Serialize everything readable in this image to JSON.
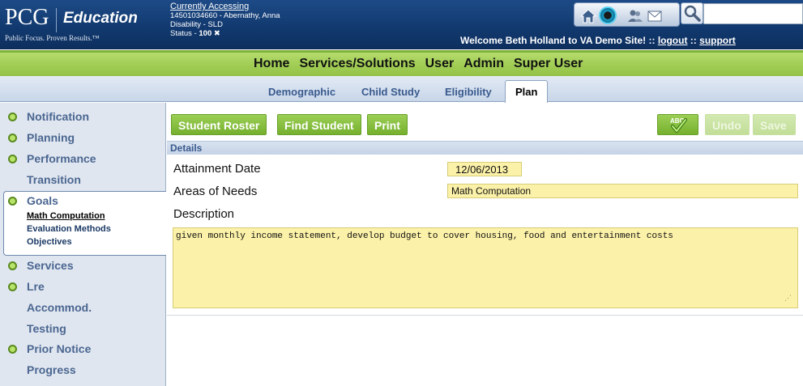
{
  "logo": {
    "brand": "PCG",
    "product": "Education",
    "tagline": "Public Focus. Proven Results.™"
  },
  "accessing": {
    "link_label": "Currently Accessing",
    "student": "14501034660 - Abernathy, Anna",
    "disability": "Disability - SLD",
    "status_prefix": "Status - ",
    "status_value": "100 ✖"
  },
  "header": {
    "icons": [
      "home-icon",
      "circle-icon",
      "users-icon",
      "mail-icon",
      "search-icon"
    ],
    "search_placeholder": "",
    "welcome_text": "Welcome Beth Holland to VA Demo Site!",
    "sep1": " :: ",
    "logout_label": "logout",
    "sep2": " :: ",
    "support_label": "support"
  },
  "main_nav": {
    "items": [
      "Home",
      "Services/Solutions",
      "User",
      "Admin",
      "Super User"
    ]
  },
  "tabs": {
    "items": [
      "Demographic",
      "Child Study",
      "Eligibility",
      "Plan"
    ],
    "active": "Plan"
  },
  "sidebar": {
    "items": [
      {
        "label": "Notification",
        "has_dot": true
      },
      {
        "label": "Planning",
        "has_dot": true
      },
      {
        "label": "Performance",
        "has_dot": true
      },
      {
        "label": "Transition",
        "has_dot": false
      },
      {
        "label": "Goals",
        "has_dot": true
      },
      {
        "label": "Services",
        "has_dot": true
      },
      {
        "label": "Lre",
        "has_dot": true
      },
      {
        "label": "Accommod.",
        "has_dot": false
      },
      {
        "label": "Testing",
        "has_dot": false
      },
      {
        "label": "Prior Notice",
        "has_dot": true
      },
      {
        "label": "Progress",
        "has_dot": false
      }
    ],
    "goals_sub": [
      "Math Computation",
      "Evaluation Methods",
      "Objectives"
    ]
  },
  "toolbar": {
    "student_roster": "Student Roster",
    "find_student": "Find Student",
    "print": "Print",
    "spell_label": "ABC",
    "undo": "Undo",
    "save": "Save"
  },
  "details": {
    "section_title": "Details",
    "attainment_label": "Attainment Date",
    "attainment_value": "12/06/2013",
    "areas_label": "Areas of Needs",
    "areas_value": "Math Computation",
    "description_label": "Description",
    "description_value": "given monthly income statement, develop budget to cover housing, food and entertainment costs"
  },
  "colors": {
    "header_blue": "#123a70",
    "nav_green": "#a5d05a",
    "button_green": "#76b02e",
    "field_yellow": "#fbf1a8",
    "sidebar_bg": "#dfe6f0"
  }
}
